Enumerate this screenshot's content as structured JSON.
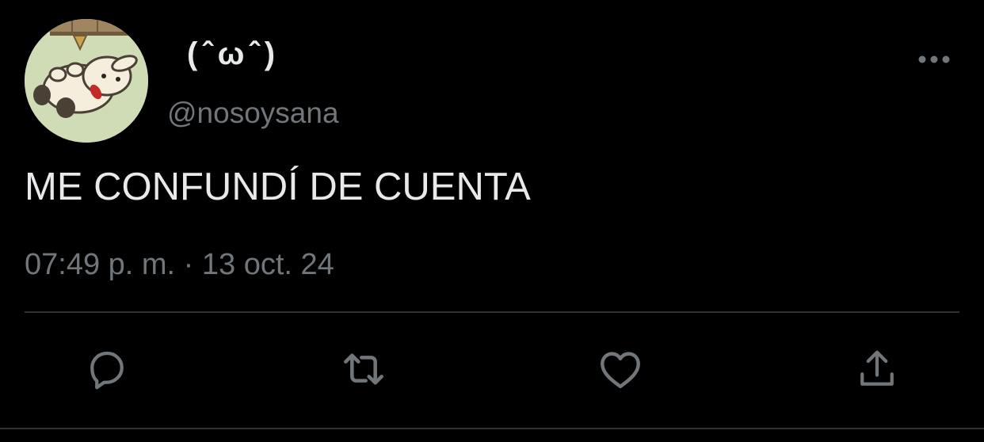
{
  "tweet": {
    "display_name": "(ˆωˆ)",
    "handle": "@nosoysana",
    "text": "ME CONFUNDÍ DE CUENTA",
    "timestamp": "07:49 p. m. · 13 oct. 24"
  },
  "icons": {
    "more": "more-horizontal-icon",
    "reply": "reply-icon",
    "retweet": "retweet-icon",
    "like": "heart-icon",
    "share": "share-icon"
  },
  "colors": {
    "background": "#000000",
    "primary_text": "#e7e9ea",
    "secondary_text": "#71767b",
    "divider": "#2f3336"
  }
}
